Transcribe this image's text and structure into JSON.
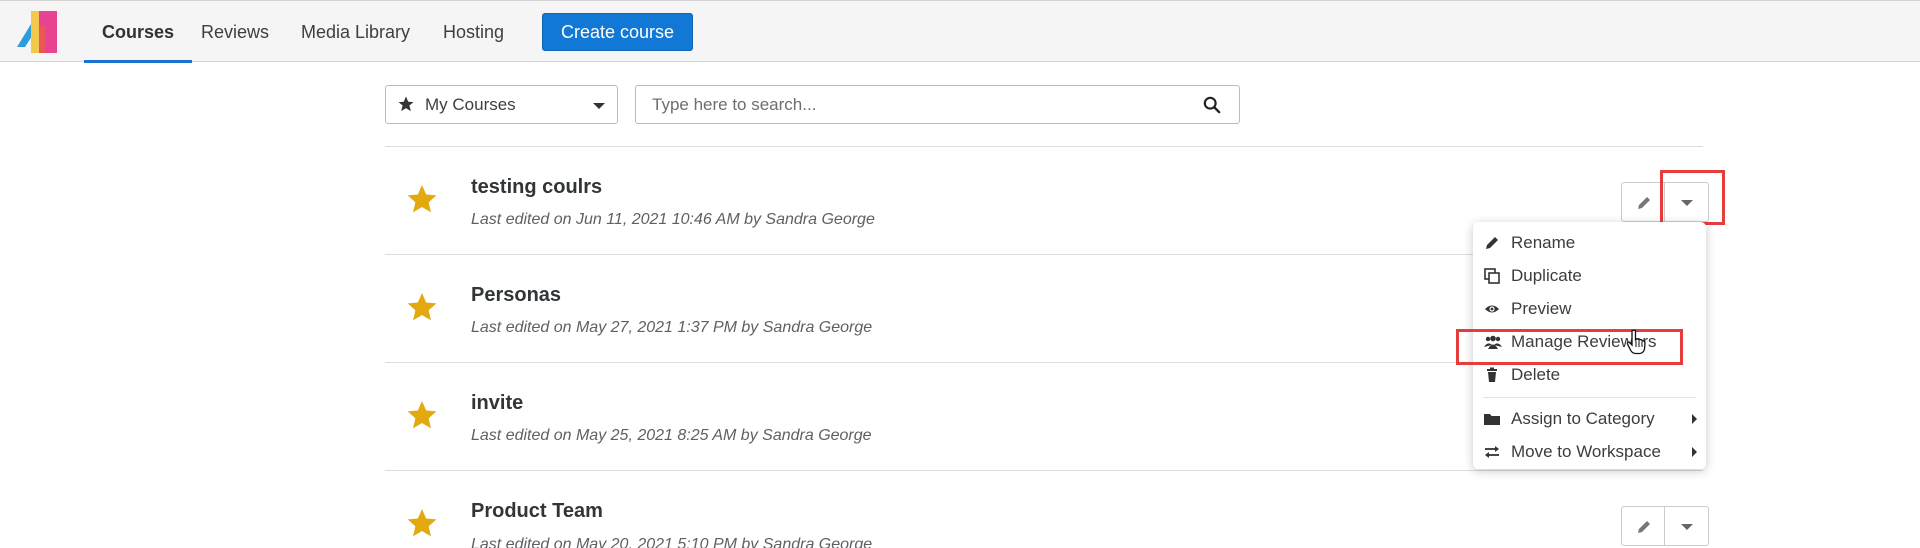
{
  "nav": {
    "tabs": [
      {
        "label": "Courses",
        "active": true
      },
      {
        "label": "Reviews",
        "active": false
      },
      {
        "label": "Media Library",
        "active": false
      },
      {
        "label": "Hosting",
        "active": false
      }
    ],
    "create_label": "Create course"
  },
  "filter": {
    "selected": "My Courses",
    "icon": "star-icon"
  },
  "search": {
    "placeholder": "Type here to search...",
    "value": "",
    "icon": "search-icon"
  },
  "courses": [
    {
      "title": "testing coulrs",
      "meta": "Last edited on Jun 11, 2021 10:46 AM by Sandra George",
      "starred": true
    },
    {
      "title": "Personas",
      "meta": "Last edited on May 27, 2021 1:37 PM by Sandra George",
      "starred": true
    },
    {
      "title": "invite",
      "meta": "Last edited on May 25, 2021 8:25 AM by Sandra George",
      "starred": true
    },
    {
      "title": "Product Team",
      "meta": "Last edited on May 20, 2021 5:10 PM by Sandra George",
      "starred": true
    }
  ],
  "menu": {
    "items": [
      {
        "label": "Rename",
        "icon": "pencil-icon"
      },
      {
        "label": "Duplicate",
        "icon": "copy-icon"
      },
      {
        "label": "Preview",
        "icon": "eye-icon"
      },
      {
        "label": "Manage Reviewers",
        "icon": "users-icon"
      },
      {
        "label": "Delete",
        "icon": "trash-icon"
      },
      {
        "label": "Assign to Category",
        "icon": "folder-icon",
        "submenu": true
      },
      {
        "label": "Move to Workspace",
        "icon": "exchange-icon",
        "submenu": true
      }
    ]
  },
  "colors": {
    "accent": "#1278d6",
    "star": "#e2aa0e",
    "highlight": "#e53c3c"
  }
}
